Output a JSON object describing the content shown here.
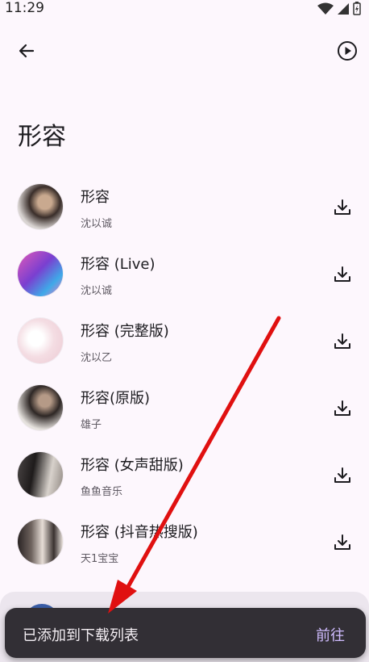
{
  "status_bar": {
    "time": "11:29"
  },
  "header": {
    "title": "形容"
  },
  "songs": [
    {
      "title": "形容",
      "artist": "沈以诚"
    },
    {
      "title": "形容 (Live)",
      "artist": "沈以诚"
    },
    {
      "title": "形容 (完整版)",
      "artist": "沈以乙"
    },
    {
      "title": "形容(原版)",
      "artist": "雄子"
    },
    {
      "title": "形容 (女声甜版)",
      "artist": "鱼鱼音乐"
    },
    {
      "title": "形容 (抖音热搜版)",
      "artist": "天1宝宝"
    }
  ],
  "snackbar": {
    "message": "已添加到下载列表",
    "action": "前往"
  },
  "colors": {
    "accent": "#d0bcff",
    "annotation_arrow": "#e01010",
    "background": "#fdf7fd"
  }
}
